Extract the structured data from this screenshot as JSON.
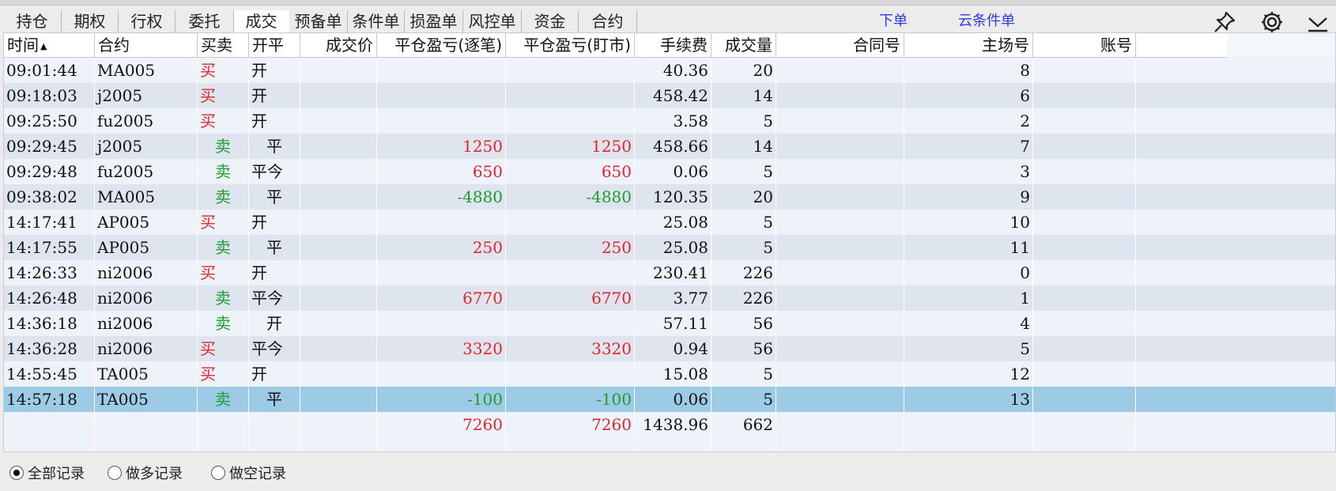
{
  "tabs": [
    {
      "label": "持仓",
      "active": false
    },
    {
      "label": "期权",
      "active": false
    },
    {
      "label": "行权",
      "active": false
    },
    {
      "label": "委托",
      "active": false
    },
    {
      "label": "成交",
      "active": true
    },
    {
      "label": "预备单",
      "active": false
    },
    {
      "label": "条件单",
      "active": false
    },
    {
      "label": "损盈单",
      "active": false
    },
    {
      "label": "风控单",
      "active": false
    },
    {
      "label": "资金",
      "active": false
    },
    {
      "label": "合约",
      "active": false
    }
  ],
  "links": {
    "place_order": "下单",
    "cloud_conditional": "云条件单"
  },
  "icons": {
    "pin": "pin-icon",
    "settings": "gear-icon",
    "collapse": "chevron-down-icon"
  },
  "columns": [
    "时间",
    "合约",
    "买卖",
    "开平",
    "成交价",
    "平仓盈亏(逐笔)",
    "平仓盈亏(盯市)",
    "手续费",
    "成交量",
    "合同号",
    "主场号",
    "账号"
  ],
  "sort_indicator": "▲",
  "colors": {
    "buy": "#e0242f",
    "sell": "#1f9b33",
    "selected_row": "#9dcbe6",
    "link": "#2d3ddb"
  },
  "rows": [
    {
      "time": "09:01:44",
      "contract": "MA005",
      "side": "买",
      "open_close": "开",
      "price": "",
      "pnl_trade": "",
      "pnl_mark": "",
      "fee": "40.36",
      "qty": "20",
      "contract_no": "",
      "seq": "8",
      "account": ""
    },
    {
      "time": "09:18:03",
      "contract": "j2005",
      "side": "买",
      "open_close": "开",
      "price": "",
      "pnl_trade": "",
      "pnl_mark": "",
      "fee": "458.42",
      "qty": "14",
      "contract_no": "",
      "seq": "6",
      "account": ""
    },
    {
      "time": "09:25:50",
      "contract": "fu2005",
      "side": "买",
      "open_close": "开",
      "price": "",
      "pnl_trade": "",
      "pnl_mark": "",
      "fee": "3.58",
      "qty": "5",
      "contract_no": "",
      "seq": "2",
      "account": ""
    },
    {
      "time": "09:29:45",
      "contract": "j2005",
      "side": "卖",
      "open_close": "平",
      "price": "",
      "pnl_trade": "1250",
      "pnl_mark": "1250",
      "fee": "458.66",
      "qty": "14",
      "contract_no": "",
      "seq": "7",
      "account": ""
    },
    {
      "time": "09:29:48",
      "contract": "fu2005",
      "side": "卖",
      "open_close": "平今",
      "price": "",
      "pnl_trade": "650",
      "pnl_mark": "650",
      "fee": "0.06",
      "qty": "5",
      "contract_no": "",
      "seq": "3",
      "account": ""
    },
    {
      "time": "09:38:02",
      "contract": "MA005",
      "side": "卖",
      "open_close": "平",
      "price": "",
      "pnl_trade": "-4880",
      "pnl_mark": "-4880",
      "fee": "120.35",
      "qty": "20",
      "contract_no": "",
      "seq": "9",
      "account": ""
    },
    {
      "time": "14:17:41",
      "contract": "AP005",
      "side": "买",
      "open_close": "开",
      "price": "",
      "pnl_trade": "",
      "pnl_mark": "",
      "fee": "25.08",
      "qty": "5",
      "contract_no": "",
      "seq": "10",
      "account": ""
    },
    {
      "time": "14:17:55",
      "contract": "AP005",
      "side": "卖",
      "open_close": "平",
      "price": "",
      "pnl_trade": "250",
      "pnl_mark": "250",
      "fee": "25.08",
      "qty": "5",
      "contract_no": "",
      "seq": "11",
      "account": ""
    },
    {
      "time": "14:26:33",
      "contract": "ni2006",
      "side": "买",
      "open_close": "开",
      "price": "",
      "pnl_trade": "",
      "pnl_mark": "",
      "fee": "230.41",
      "qty": "226",
      "contract_no": "",
      "seq": "0",
      "account": ""
    },
    {
      "time": "14:26:48",
      "contract": "ni2006",
      "side": "卖",
      "open_close": "平今",
      "price": "",
      "pnl_trade": "6770",
      "pnl_mark": "6770",
      "fee": "3.77",
      "qty": "226",
      "contract_no": "",
      "seq": "1",
      "account": ""
    },
    {
      "time": "14:36:18",
      "contract": "ni2006",
      "side": "卖",
      "open_close": "开",
      "price": "",
      "pnl_trade": "",
      "pnl_mark": "",
      "fee": "57.11",
      "qty": "56",
      "contract_no": "",
      "seq": "4",
      "account": ""
    },
    {
      "time": "14:36:28",
      "contract": "ni2006",
      "side": "买",
      "open_close": "平今",
      "price": "",
      "pnl_trade": "3320",
      "pnl_mark": "3320",
      "fee": "0.94",
      "qty": "56",
      "contract_no": "",
      "seq": "5",
      "account": ""
    },
    {
      "time": "14:55:45",
      "contract": "TA005",
      "side": "买",
      "open_close": "开",
      "price": "",
      "pnl_trade": "",
      "pnl_mark": "",
      "fee": "15.08",
      "qty": "5",
      "contract_no": "",
      "seq": "12",
      "account": ""
    },
    {
      "time": "14:57:18",
      "contract": "TA005",
      "side": "卖",
      "open_close": "平",
      "price": "",
      "pnl_trade": "-100",
      "pnl_mark": "-100",
      "fee": "0.06",
      "qty": "5",
      "contract_no": "",
      "seq": "13",
      "account": "",
      "selected": true
    }
  ],
  "totals": {
    "pnl_trade": "7260",
    "pnl_mark": "7260",
    "fee": "1438.96",
    "qty": "662"
  },
  "filters": [
    {
      "label": "全部记录",
      "checked": true
    },
    {
      "label": "做多记录",
      "checked": false
    },
    {
      "label": "做空记录",
      "checked": false
    }
  ]
}
